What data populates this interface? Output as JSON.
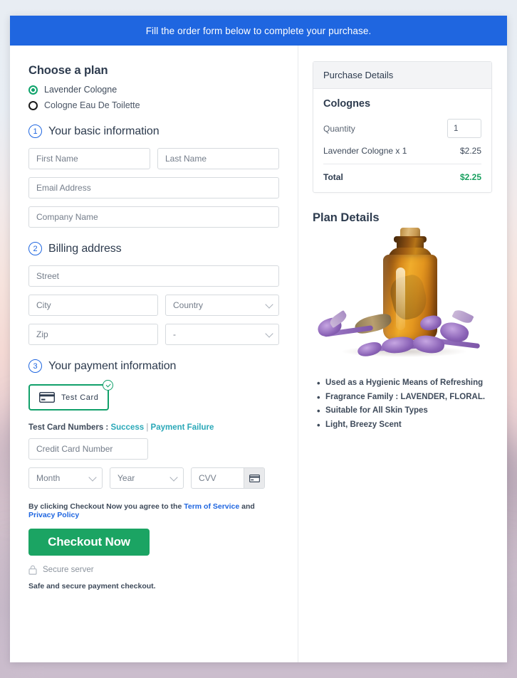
{
  "banner": {
    "text": "Fill the order form below to complete your purchase."
  },
  "plan": {
    "heading": "Choose a plan",
    "options": [
      {
        "label": "Lavender Cologne",
        "selected": true
      },
      {
        "label": "Cologne Eau De Toilette",
        "selected": false
      }
    ]
  },
  "steps": {
    "basic": {
      "number": "1",
      "title": "Your basic information"
    },
    "billing": {
      "number": "2",
      "title": "Billing address"
    },
    "payment": {
      "number": "3",
      "title": "Your payment information"
    }
  },
  "fields": {
    "first_name": {
      "placeholder": "First Name",
      "value": ""
    },
    "last_name": {
      "placeholder": "Last Name",
      "value": ""
    },
    "email": {
      "placeholder": "Email Address",
      "value": ""
    },
    "company": {
      "placeholder": "Company Name",
      "value": ""
    },
    "street": {
      "placeholder": "Street",
      "value": ""
    },
    "city": {
      "placeholder": "City",
      "value": ""
    },
    "country": {
      "placeholder": "Country",
      "value": ""
    },
    "zip": {
      "placeholder": "Zip",
      "value": ""
    },
    "state": {
      "placeholder": "-",
      "value": ""
    },
    "card_number": {
      "placeholder": "Credit Card Number",
      "value": ""
    },
    "month": {
      "placeholder": "Month",
      "value": ""
    },
    "year": {
      "placeholder": "Year",
      "value": ""
    },
    "cvv": {
      "placeholder": "CVV",
      "value": ""
    }
  },
  "payment_method": {
    "label": "Test Card",
    "selected": true,
    "icon": "credit-card-icon",
    "badge_icon": "check-circle-icon"
  },
  "test_numbers": {
    "prefix": "Test Card Numbers : ",
    "success_link": "Success",
    "separator": " | ",
    "failure_link": "Payment Failure"
  },
  "agreement": {
    "prefix": "By clicking Checkout Now you agree to the ",
    "terms_link": "Term of Service",
    "middle": " and ",
    "privacy_link": "Privacy Policy"
  },
  "checkout": {
    "button_label": "Checkout Now",
    "secure_text": "Secure server",
    "secure_icon": "lock-icon",
    "safe_note": "Safe and secure payment checkout."
  },
  "purchase": {
    "header": "Purchase Details",
    "product_group": "Colognes",
    "quantity_label": "Quantity",
    "quantity_value": "1",
    "line_item": {
      "label": "Lavender Cologne x 1",
      "amount": "$2.25"
    },
    "total": {
      "label": "Total",
      "amount": "$2.25"
    }
  },
  "plan_details": {
    "heading": "Plan Details",
    "image_alt": "lavender-cologne-bottle-image",
    "bullets": [
      "Used as a Hygienic Means of Refreshing",
      "Fragrance Family : LAVENDER, FLORAL.",
      "Suitable for All Skin Types",
      "Light, Breezy Scent"
    ]
  },
  "colors": {
    "banner_blue": "#1f66e0",
    "accent_green": "#1ba463",
    "total_green": "#18a05f",
    "link_teal": "#2aa8b8",
    "link_blue": "#1f66e0",
    "radio_green": "#0fa36b",
    "text_dark": "#2d3b4e"
  }
}
